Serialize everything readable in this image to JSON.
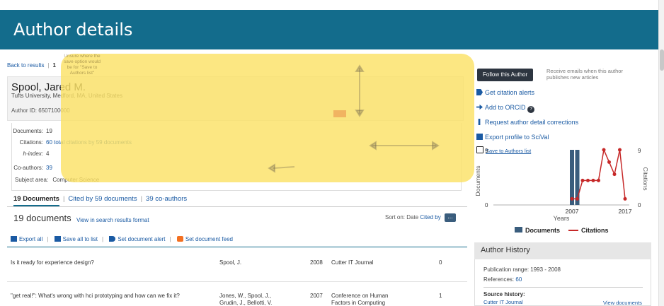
{
  "header": {
    "title": "Author details"
  },
  "topnav": {
    "back": "Back to results",
    "page": "1"
  },
  "author": {
    "name": "Spool, Jared M.",
    "affiliation": "Tufts University, Medford, MA, United States",
    "id_label": "Author ID:",
    "id_value": "6507100000"
  },
  "metrics": {
    "documents_label": "Documents:",
    "documents_value": "19",
    "citations_label": "Citations:",
    "citations_value": "60 total citations by 59 documents",
    "hindex_label": "h-index:",
    "hindex_value": "4",
    "coauthors_label": "Co-authors:",
    "coauthors_value": "39",
    "subject_label": "Subject area:",
    "subject_value": "Computer Science"
  },
  "tabs": {
    "documents": "19 Documents",
    "cited_by": "Cited by 59 documents",
    "coauthors": "39 co-authors"
  },
  "results": {
    "count": "19 documents",
    "view_link": "View in search results format",
    "sort_label": "Sort on:",
    "sort_date": "Date",
    "sort_cited": "Cited by",
    "sort_more": "..."
  },
  "doc_actions": {
    "export": "Export all",
    "save": "Save all to list",
    "alert": "Set document alert",
    "feed": "Set document feed"
  },
  "documents": [
    {
      "title": "Is it ready for experience design?",
      "authors": "Spool, J.",
      "authors2": "",
      "year": "2008",
      "source": "Cutter IT Journal",
      "source2": "",
      "cites": "0"
    },
    {
      "title": "\"get real!\": What's wrong with hci prototyping and how can we fix it?",
      "authors": "Jones, W., Spool, J.,",
      "authors2": "Grudin, J., Bellotti, V.",
      "year": "2007",
      "source": "Conference on Human",
      "source2": "Factors in Computing",
      "cites": "1"
    }
  ],
  "sidebar": {
    "follow_button": "Follow this Author",
    "follow_desc": "Receive emails when this author publishes new articles",
    "links": [
      "Get citation alerts",
      "Add to ORCID",
      "Request author detail corrections",
      "Export profile to SciVal",
      "Save to Authors list"
    ]
  },
  "chart_data": {
    "type": "bar",
    "x": [
      "1993",
      "1994",
      "1995",
      "1996",
      "1997",
      "1998",
      "1999",
      "2000",
      "2001",
      "2002",
      "2003",
      "2004",
      "2005",
      "2006",
      "2007",
      "2008",
      "2009",
      "2010",
      "2011",
      "2012",
      "2013",
      "2014",
      "2015",
      "2016",
      "2017"
    ],
    "xticks": [
      "2007",
      "2017"
    ],
    "xlabel": "Years",
    "ylabel_left": "Documents",
    "ylabel_right": "Citations",
    "ylim_left": [
      0,
      9
    ],
    "ylim_right": [
      0,
      9
    ],
    "yticks": [
      "0",
      "9"
    ],
    "series": [
      {
        "name": "Documents",
        "kind": "bar",
        "x": [
          "2007",
          "2008"
        ],
        "values": [
          9,
          9
        ]
      },
      {
        "name": "Citations",
        "kind": "line",
        "x": [
          "2007",
          "2008",
          "2009",
          "2010",
          "2011",
          "2012",
          "2013",
          "2014",
          "2015",
          "2016",
          "2017"
        ],
        "values": [
          1,
          1,
          4,
          4,
          4,
          4,
          9,
          7,
          5,
          9,
          1
        ]
      }
    ],
    "colors": {
      "documents": "#3a5d7d",
      "citations": "#c62828"
    },
    "legend": [
      "Documents",
      "Citations"
    ],
    "legend_position": "bottom"
  },
  "history": {
    "title": "Author History",
    "pub_range": "Publication range: 1993 - 2008",
    "refs_label": "References:",
    "refs_value": "60",
    "source_hist": "Source history:",
    "source_journal": "Cutter IT Journal",
    "view_docs": "View documents"
  },
  "overlay": {
    "note": "Unsure where the save option would be for \"Save to Authors list\""
  }
}
